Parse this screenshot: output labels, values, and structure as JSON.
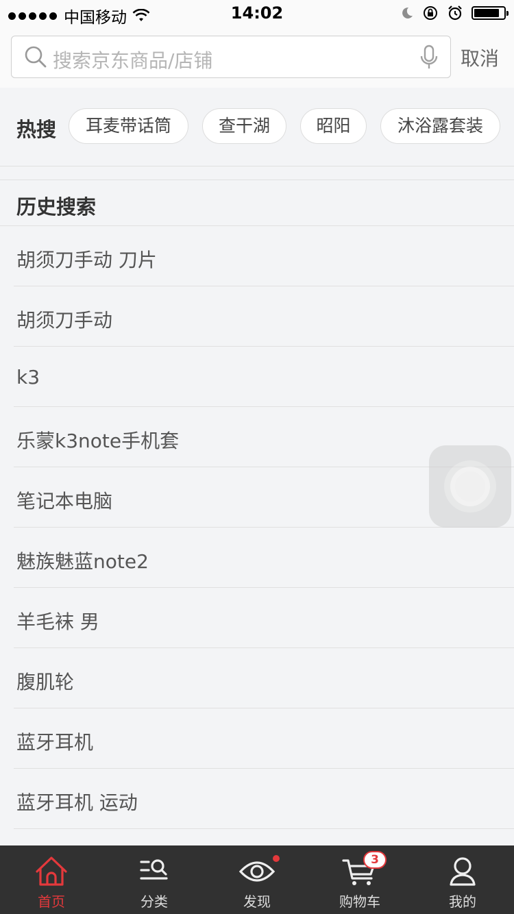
{
  "status_bar": {
    "carrier": "中国移动",
    "time": "14:02"
  },
  "search": {
    "placeholder": "搜索京东商品/店铺",
    "cancel_label": "取消"
  },
  "hot_search": {
    "title": "热搜",
    "chips": [
      "耳麦带话筒",
      "查干湖",
      "昭阳",
      "沐浴露套装"
    ]
  },
  "history": {
    "title": "历史搜索",
    "items": [
      "胡须刀手动 刀片",
      "胡须刀手动",
      "k3",
      "乐蒙k3note手机套",
      "笔记本电脑",
      "魅族魅蓝note2",
      "羊毛袜 男",
      "腹肌轮",
      "蓝牙耳机",
      "蓝牙耳机 运动"
    ]
  },
  "tabbar": {
    "tabs": [
      {
        "label": "首页",
        "icon": "home-icon",
        "active": true
      },
      {
        "label": "分类",
        "icon": "category-icon"
      },
      {
        "label": "发现",
        "icon": "discover-eye-icon",
        "dot": true
      },
      {
        "label": "购物车",
        "icon": "cart-icon",
        "badge": "3"
      },
      {
        "label": "我的",
        "icon": "profile-icon"
      }
    ]
  },
  "colors": {
    "accent": "#e4393c",
    "tabbar_bg": "#313131",
    "page_bg": "#f3f4f6"
  }
}
